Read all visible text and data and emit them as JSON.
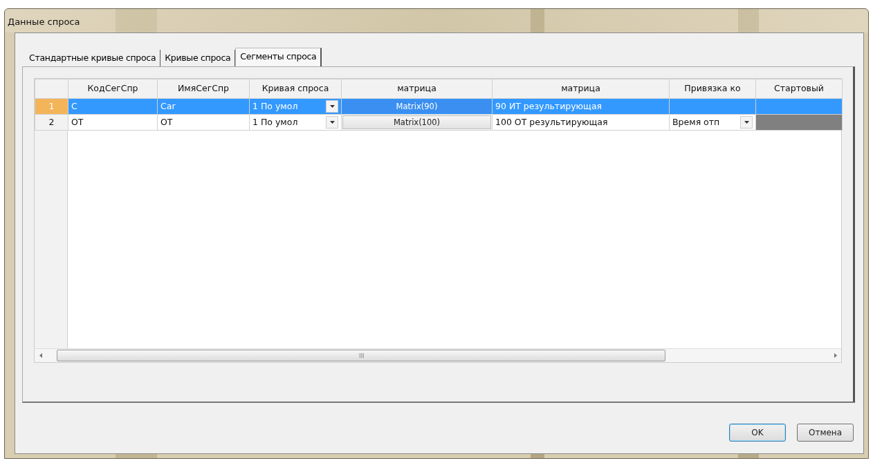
{
  "window": {
    "title": "Данные спроса"
  },
  "tabs": [
    {
      "label": "Стандартные кривые спроса",
      "selected": false
    },
    {
      "label": "Кривые спроса",
      "selected": false
    },
    {
      "label": "Сегменты спроса",
      "selected": true
    }
  ],
  "table": {
    "columns": [
      "КодСегСпр",
      "ИмяСегСпр",
      "Кривая спроса",
      "матрица",
      "матрица",
      "Привязка ко",
      "Стартовый"
    ],
    "rows": [
      {
        "number": "1",
        "selected": true,
        "cells": [
          {
            "kind": "text",
            "text": "C"
          },
          {
            "kind": "text",
            "text": "Car"
          },
          {
            "kind": "combo",
            "text": "1 По умол"
          },
          {
            "kind": "button",
            "text": "Matrix(90)"
          },
          {
            "kind": "text",
            "text": "90 ИТ результирующая"
          },
          {
            "kind": "blank"
          },
          {
            "kind": "blank"
          }
        ]
      },
      {
        "number": "2",
        "selected": false,
        "cells": [
          {
            "kind": "text",
            "text": "OT"
          },
          {
            "kind": "text",
            "text": "OT"
          },
          {
            "kind": "combo",
            "text": "1 По умол"
          },
          {
            "kind": "button",
            "text": "Matrix(100)"
          },
          {
            "kind": "text",
            "text": "100 OT результирующая"
          },
          {
            "kind": "combo",
            "text": "Время отп"
          },
          {
            "kind": "shaded"
          }
        ]
      }
    ]
  },
  "buttons": [
    {
      "label": "OK",
      "default": true
    },
    {
      "label": "Отмена",
      "default": false
    }
  ]
}
